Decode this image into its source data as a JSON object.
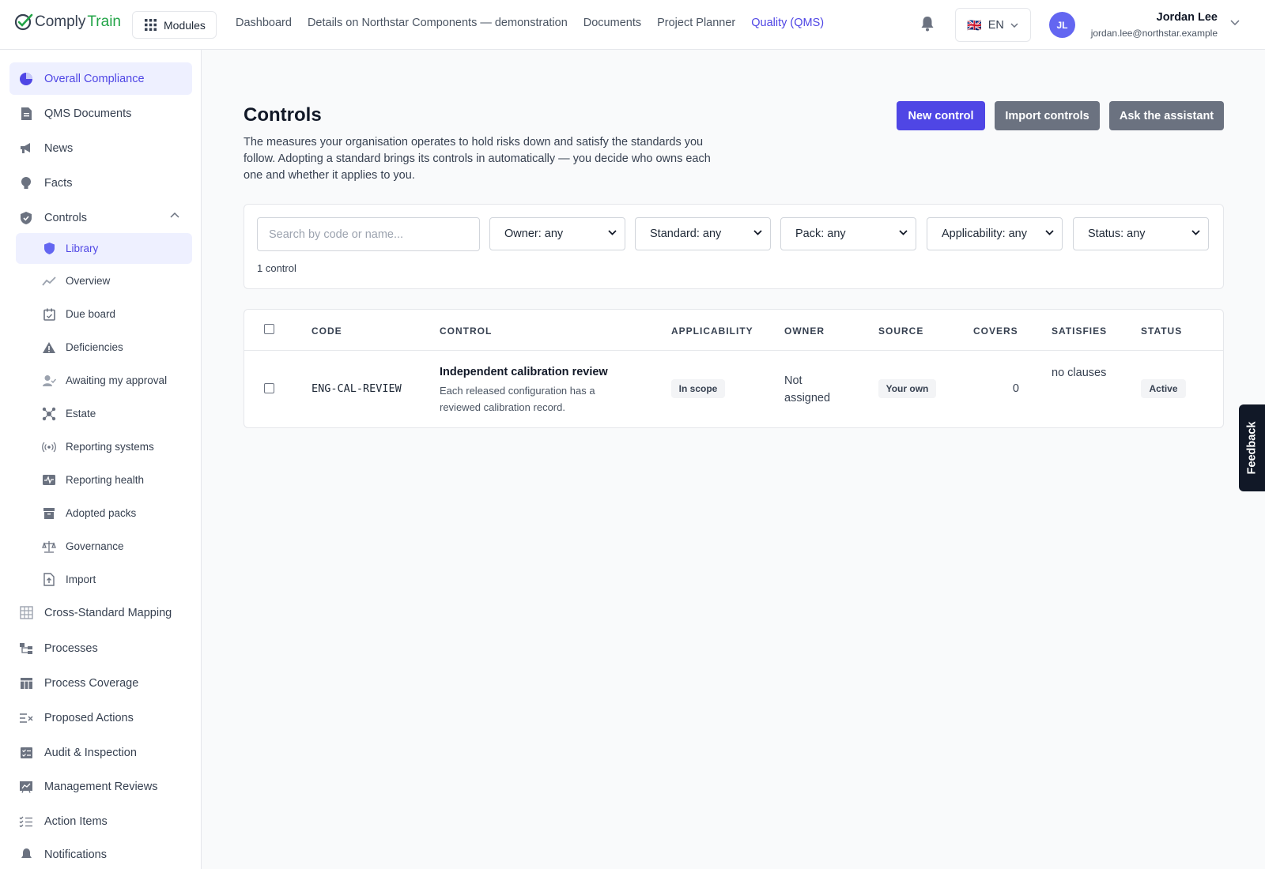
{
  "brand": {
    "part1": "Comply",
    "part2": "Train"
  },
  "topbar": {
    "modules_label": "Modules",
    "nav": [
      {
        "label": "Dashboard"
      },
      {
        "label": "Details on Northstar Components — demonstration"
      },
      {
        "label": "Documents"
      },
      {
        "label": "Project Planner"
      },
      {
        "label": "Quality (QMS)"
      }
    ],
    "language": "EN",
    "flag": "🇬🇧",
    "user": {
      "initials": "JL",
      "name": "Jordan Lee",
      "email": "jordan.lee@northstar.example"
    }
  },
  "sidebar": {
    "items": [
      {
        "label": "Overall Compliance",
        "icon": "pie-chart-icon"
      },
      {
        "label": "QMS Documents",
        "icon": "document-icon"
      },
      {
        "label": "News",
        "icon": "megaphone-icon"
      },
      {
        "label": "Facts",
        "icon": "lightbulb-icon"
      },
      {
        "label": "Controls",
        "icon": "shield-check-icon"
      },
      {
        "label": "Library",
        "icon": "shield-icon"
      },
      {
        "label": "Overview",
        "icon": "trend-icon"
      },
      {
        "label": "Due board",
        "icon": "calendar-check-icon"
      },
      {
        "label": "Deficiencies",
        "icon": "warning-icon"
      },
      {
        "label": "Awaiting my approval",
        "icon": "user-check-icon"
      },
      {
        "label": "Estate",
        "icon": "network-icon"
      },
      {
        "label": "Reporting systems",
        "icon": "signal-icon"
      },
      {
        "label": "Reporting health",
        "icon": "heartbeat-icon"
      },
      {
        "label": "Adopted packs",
        "icon": "archive-icon"
      },
      {
        "label": "Governance",
        "icon": "scale-icon"
      },
      {
        "label": "Import",
        "icon": "file-import-icon"
      },
      {
        "label": "Cross-Standard Mapping",
        "icon": "grid-icon"
      },
      {
        "label": "Processes",
        "icon": "hierarchy-icon"
      },
      {
        "label": "Process Coverage",
        "icon": "table-icon"
      },
      {
        "label": "Proposed Actions",
        "icon": "list-x-icon"
      },
      {
        "label": "Audit & Inspection",
        "icon": "checklist-icon"
      },
      {
        "label": "Management Reviews",
        "icon": "chart-board-icon"
      },
      {
        "label": "Action Items",
        "icon": "list-check-icon"
      },
      {
        "label": "Notifications",
        "icon": "bell-icon"
      }
    ]
  },
  "page": {
    "title": "Controls",
    "description": "The measures your organisation operates to hold risks down and satisfy the standards you follow. Adopting a standard brings its controls in automatically — you decide who owns each one and whether it applies to you.",
    "buttons": {
      "new": "New control",
      "import": "Import controls",
      "assistant": "Ask the assistant"
    }
  },
  "filters": {
    "search_placeholder": "Search by code or name...",
    "owner": "Owner: any",
    "standard": "Standard: any",
    "pack": "Pack: any",
    "applicability": "Applicability: any",
    "status": "Status: any",
    "count": "1 control"
  },
  "table": {
    "headers": [
      "CODE",
      "CONTROL",
      "APPLICABILITY",
      "OWNER",
      "SOURCE",
      "COVERS",
      "SATISFIES",
      "STATUS"
    ],
    "rows": [
      {
        "code": "ENG-CAL-REVIEW",
        "name": "Independent calibration review",
        "description": "Each released configuration has a reviewed calibration record.",
        "applicability": "In scope",
        "owner": "Not assigned",
        "source": "Your own",
        "covers": "0",
        "satisfies": "no clauses",
        "status": "Active"
      }
    ]
  },
  "feedback": "Feedback",
  "colors": {
    "accent": "#4f46e5",
    "brand_green": "#22a447",
    "secondary_button": "#6b7280",
    "active_nav_bg": "#eef0ff"
  }
}
